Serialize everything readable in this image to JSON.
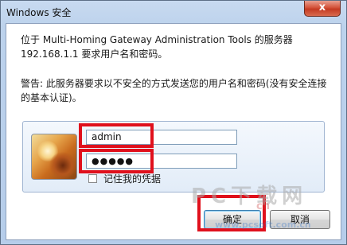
{
  "window": {
    "title": "Windows 安全",
    "close_glyph": "x"
  },
  "message": {
    "line1": "位于 Multi-Homing Gateway Administration Tools 的服务器",
    "line2": "192.168.1.1 要求用户名和密码。",
    "warning_line1": "警告: 此服务器要求以不安全的方式发送您的用户名和密码(没有安全连接",
    "warning_line2": "的基本认证)。"
  },
  "credentials": {
    "username_value": "admin",
    "password_masked": "●●●●●",
    "remember_label": "记住我的凭据",
    "remember_checked": false,
    "user_tile_icon": "user-picture-flower"
  },
  "buttons": {
    "ok_label": "确定",
    "cancel_label": "取消"
  },
  "annotations": {
    "highlight_color": "#e0101c"
  },
  "watermark": {
    "big": "PC下载网",
    "small": "cn",
    "url": "www.pcsoft.com.cn"
  }
}
